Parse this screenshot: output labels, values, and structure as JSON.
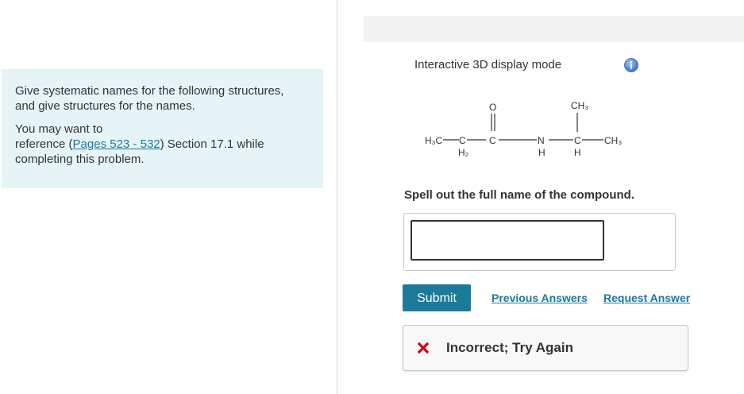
{
  "instructions": {
    "line1": "Give systematic names for the following structures,",
    "line2": "and give structures for the names.",
    "ref_prefix": "You may want to",
    "ref_mid": "reference (",
    "ref_link": "Pages 523 - 532",
    "ref_suffix": ") Section 17.1 while",
    "ref_end": "completing this problem."
  },
  "viewer": {
    "mode_label": "Interactive 3D display mode",
    "info_icon": "info-icon"
  },
  "structure": {
    "atoms": {
      "h3c": "H₃C",
      "c1": "C",
      "h2": "H₂",
      "c2": "C",
      "o": "O",
      "n": "N",
      "nh": "H",
      "c3": "C",
      "ch": "H",
      "ch3_top": "CH₃",
      "ch3_right": "CH₃"
    }
  },
  "question": {
    "prompt": "Spell out the full name of the compound.",
    "answer_value": ""
  },
  "actions": {
    "submit_label": "Submit",
    "previous_answers": "Previous Answers",
    "request_answer": "Request Answer"
  },
  "feedback": {
    "icon": "x-icon",
    "text": "Incorrect; Try Again",
    "color": "#d0021b"
  },
  "colors": {
    "accent": "#1b7b99",
    "panel": "#e6f4f7"
  }
}
